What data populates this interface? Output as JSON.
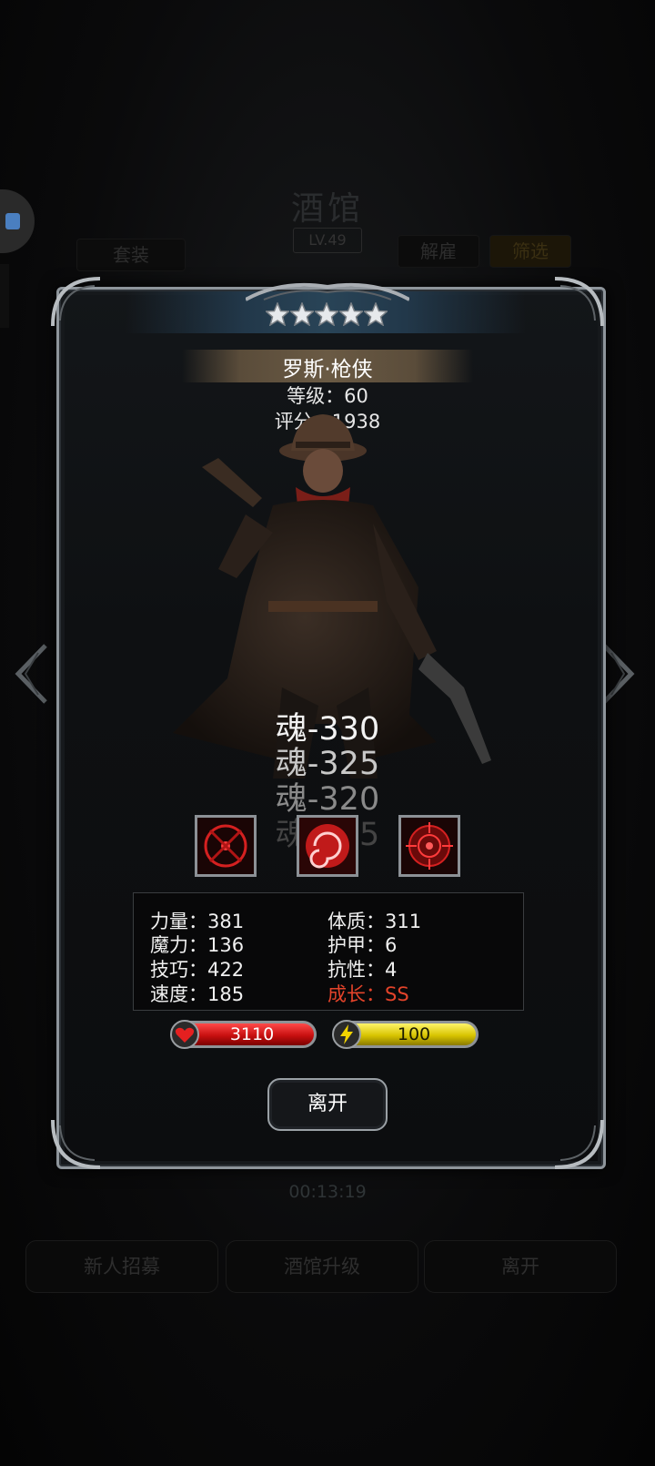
{
  "background": {
    "title": "酒馆",
    "level": "LV.49",
    "buttons": {
      "outfit": "套装",
      "dismiss": "解雇",
      "filter": "筛选"
    },
    "timer": "00:13:19",
    "bottom_buttons": [
      "新人招募",
      "酒馆升级",
      "离开"
    ]
  },
  "hero": {
    "stars": 5,
    "name": "罗斯·枪侠",
    "level_text": "等级：60",
    "score_text": "评分：1938"
  },
  "souls": [
    "魂-330",
    "魂-325",
    "魂-320",
    "魂-315"
  ],
  "skills": [
    {
      "icon": "crosshair-skill-icon"
    },
    {
      "icon": "swirl-skill-icon"
    },
    {
      "icon": "target-skill-icon"
    }
  ],
  "stats": {
    "strength": "力量：381",
    "constitution": "体质：311",
    "magic": "魔力：136",
    "armor": "护甲：6",
    "skill": "技巧：422",
    "resistance": "抗性：4",
    "speed": "速度：185",
    "growth": "成长：SS"
  },
  "bars": {
    "hp": "3110",
    "energy": "100"
  },
  "leave_label": "离开",
  "colors": {
    "growth": "#e3432a",
    "hp": "#c81010",
    "energy": "#d8c400",
    "frame": "#8e959b"
  }
}
